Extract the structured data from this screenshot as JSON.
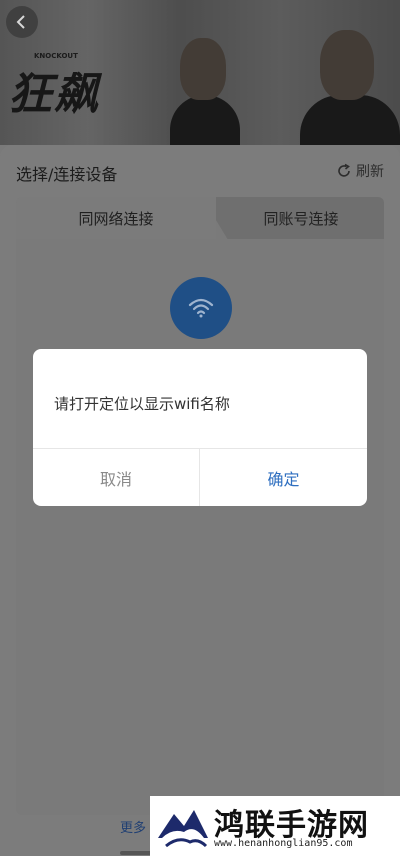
{
  "poster": {
    "title": "狂飙",
    "small_text": "KNOCKOUT"
  },
  "sheet": {
    "title": "选择/连接设备",
    "refresh_label": "刷新",
    "tabs": [
      {
        "label": "同网络连接",
        "active": true
      },
      {
        "label": "同账号连接",
        "active": false
      }
    ],
    "more_label": "更多"
  },
  "dialog": {
    "message": "请打开定位以显示wifi名称",
    "cancel_label": "取消",
    "confirm_label": "确定"
  },
  "watermark": {
    "name": "鸿联手游网",
    "url": "www.henanhonglian95.com"
  },
  "colors": {
    "accent": "#2f6fc0",
    "wifi_circle": "#1f4f86",
    "overlay": "#7a7a7a"
  },
  "icons": {
    "back": "back-arrow-icon",
    "refresh": "refresh-icon",
    "wifi": "wifi-icon"
  }
}
